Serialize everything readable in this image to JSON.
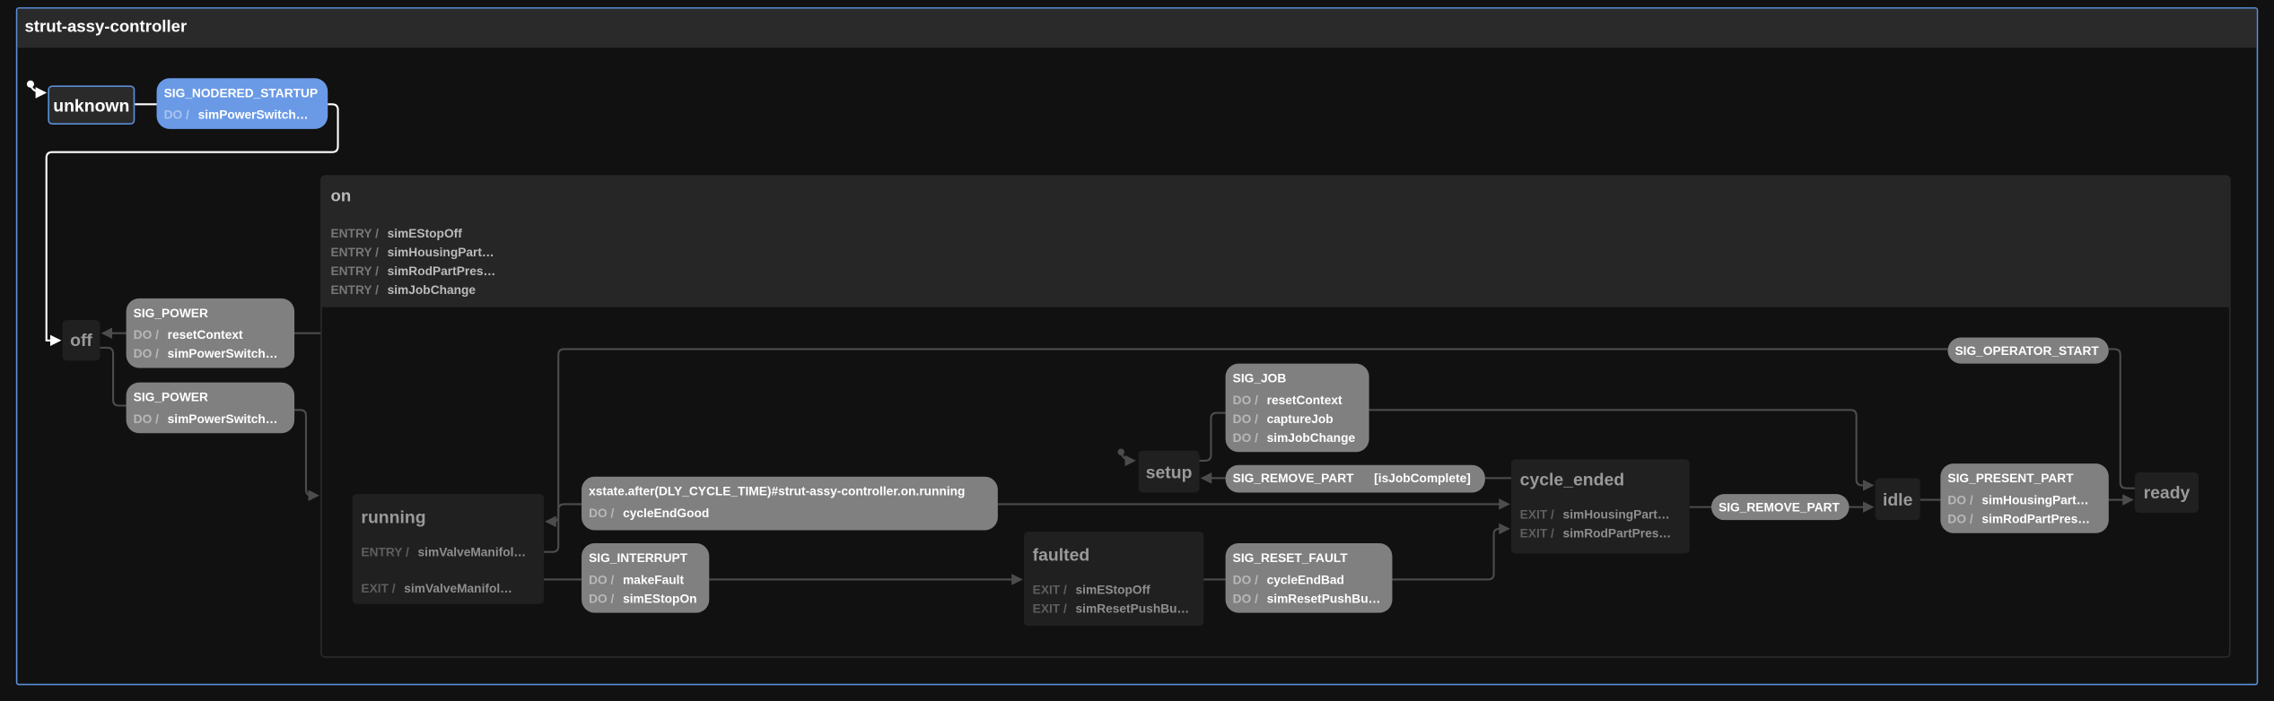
{
  "machine": {
    "title": "strut-assy-controller"
  },
  "labels": {
    "entry": "ENTRY /",
    "exit": "EXIT /",
    "do": "DO /"
  },
  "states": {
    "unknown": {
      "label": "unknown"
    },
    "off": {
      "label": "off"
    },
    "on": {
      "label": "on",
      "entry": [
        "simEStopOff",
        "simHousingPart…",
        "simRodPartPres…",
        "simJobChange"
      ]
    },
    "running": {
      "label": "running",
      "entry": [
        "simValveManifol…"
      ],
      "exit": [
        "simValveManifol…"
      ]
    },
    "faulted": {
      "label": "faulted",
      "exit": [
        "simEStopOff",
        "simResetPushBu…"
      ]
    },
    "setup": {
      "label": "setup"
    },
    "cycle_ended": {
      "label": "cycle_ended",
      "exit": [
        "simHousingPart…",
        "simRodPartPres…"
      ]
    },
    "idle": {
      "label": "idle"
    },
    "ready": {
      "label": "ready"
    }
  },
  "transitions": {
    "nodered_startup": {
      "event": "SIG_NODERED_STARTUP",
      "actions": [
        "simPowerSwitch…"
      ]
    },
    "power_off": {
      "event": "SIG_POWER",
      "actions": [
        "resetContext",
        "simPowerSwitch…"
      ]
    },
    "power_on": {
      "event": "SIG_POWER",
      "actions": [
        "simPowerSwitch…"
      ]
    },
    "after_cycle": {
      "event": "xstate.after(DLY_CYCLE_TIME)#strut-assy-controller.on.running",
      "actions": [
        "cycleEndGood"
      ]
    },
    "interrupt": {
      "event": "SIG_INTERRUPT",
      "actions": [
        "makeFault",
        "simEStopOn"
      ]
    },
    "reset_fault": {
      "event": "SIG_RESET_FAULT",
      "actions": [
        "cycleEndBad",
        "simResetPushBu…"
      ]
    },
    "job": {
      "event": "SIG_JOB",
      "actions": [
        "resetContext",
        "captureJob",
        "simJobChange"
      ]
    },
    "remove_part_complete": {
      "event": "SIG_REMOVE_PART",
      "guard": "[isJobComplete]"
    },
    "remove_part": {
      "event": "SIG_REMOVE_PART"
    },
    "present_part": {
      "event": "SIG_PRESENT_PART",
      "actions": [
        "simHousingPart…",
        "simRodPartPres…"
      ]
    },
    "operator_start": {
      "event": "SIG_OPERATOR_START"
    }
  },
  "colors": {
    "active": "#5b8fd9",
    "active_transition": "#6a9ae6",
    "transition": "#808080",
    "background": "#111111"
  }
}
